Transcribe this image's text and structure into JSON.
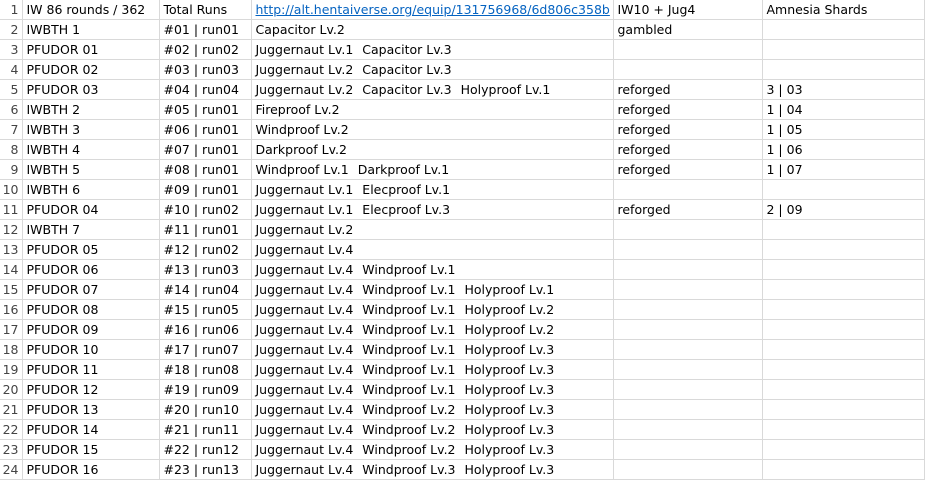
{
  "header": {
    "row_num": "1",
    "a": "IW 86 rounds / 362",
    "b": "Total Runs",
    "c": "http://alt.hentaiverse.org/equip/131756968/6d806c358b",
    "d": "IW10 + Jug4",
    "e": "Amnesia Shards"
  },
  "rows": [
    {
      "num": "2",
      "name": "IWBTH 1",
      "run": "#01 | run01",
      "p1": "Capacitor Lv.2",
      "p2": "",
      "p3": "",
      "status": "gambled",
      "shards": ""
    },
    {
      "num": "3",
      "name": "PFUDOR 01",
      "run": "#02 | run02",
      "p1": "Juggernaut Lv.1",
      "p2": "Capacitor Lv.3",
      "p3": "",
      "status": "",
      "shards": ""
    },
    {
      "num": "4",
      "name": "PFUDOR 02",
      "run": "#03 | run03",
      "p1": "Juggernaut Lv.2",
      "p2": "Capacitor Lv.3",
      "p3": "",
      "status": "",
      "shards": ""
    },
    {
      "num": "5",
      "name": "PFUDOR 03",
      "run": "#04 | run04",
      "p1": "Juggernaut Lv.2",
      "p2": "Capacitor Lv.3",
      "p3": "Holyproof Lv.1",
      "status": "reforged",
      "shards": "3 | 03"
    },
    {
      "num": "6",
      "name": "IWBTH 2",
      "run": "#05 | run01",
      "p1": "Fireproof Lv.2",
      "p2": "",
      "p3": "",
      "status": "reforged",
      "shards": "1 | 04"
    },
    {
      "num": "7",
      "name": "IWBTH 3",
      "run": "#06 | run01",
      "p1": "Windproof Lv.2",
      "p2": "",
      "p3": "",
      "status": "reforged",
      "shards": "1 | 05"
    },
    {
      "num": "8",
      "name": "IWBTH 4",
      "run": "#07 | run01",
      "p1": "Darkproof Lv.2",
      "p2": "",
      "p3": "",
      "status": "reforged",
      "shards": "1 | 06"
    },
    {
      "num": "9",
      "name": "IWBTH 5",
      "run": "#08 | run01",
      "p1": "Windproof Lv.1",
      "p2": "Darkproof Lv.1",
      "p3": "",
      "status": "reforged",
      "shards": "1 | 07"
    },
    {
      "num": "10",
      "name": "IWBTH 6",
      "run": "#09 | run01",
      "p1": "Juggernaut Lv.1",
      "p2": "Elecproof Lv.1",
      "p3": "",
      "status": "",
      "shards": ""
    },
    {
      "num": "11",
      "name": "PFUDOR 04",
      "run": "#10 | run02",
      "p1": "Juggernaut Lv.1",
      "p2": "Elecproof Lv.3",
      "p3": "",
      "status": "reforged",
      "shards": "2 | 09"
    },
    {
      "num": "12",
      "name": "IWBTH 7",
      "run": "#11 | run01",
      "p1": "Juggernaut Lv.2",
      "p2": "",
      "p3": "",
      "status": "",
      "shards": ""
    },
    {
      "num": "13",
      "name": "PFUDOR 05",
      "run": "#12 | run02",
      "p1": "Juggernaut Lv.4",
      "p2": "",
      "p3": "",
      "status": "",
      "shards": ""
    },
    {
      "num": "14",
      "name": "PFUDOR 06",
      "run": "#13 | run03",
      "p1": "Juggernaut Lv.4",
      "p2": "Windproof Lv.1",
      "p3": "",
      "status": "",
      "shards": ""
    },
    {
      "num": "15",
      "name": "PFUDOR 07",
      "run": "#14 | run04",
      "p1": "Juggernaut Lv.4",
      "p2": "Windproof Lv.1",
      "p3": "Holyproof Lv.1",
      "status": "",
      "shards": ""
    },
    {
      "num": "16",
      "name": "PFUDOR 08",
      "run": "#15 | run05",
      "p1": "Juggernaut Lv.4",
      "p2": "Windproof Lv.1",
      "p3": "Holyproof Lv.2",
      "status": "",
      "shards": ""
    },
    {
      "num": "17",
      "name": "PFUDOR 09",
      "run": "#16 | run06",
      "p1": "Juggernaut Lv.4",
      "p2": "Windproof Lv.1",
      "p3": "Holyproof Lv.2",
      "status": "",
      "shards": ""
    },
    {
      "num": "18",
      "name": "PFUDOR 10",
      "run": "#17 | run07",
      "p1": "Juggernaut Lv.4",
      "p2": "Windproof Lv.1",
      "p3": "Holyproof Lv.3",
      "status": "",
      "shards": ""
    },
    {
      "num": "19",
      "name": "PFUDOR 11",
      "run": "#18 | run08",
      "p1": "Juggernaut Lv.4",
      "p2": "Windproof Lv.1",
      "p3": "Holyproof Lv.3",
      "status": "",
      "shards": ""
    },
    {
      "num": "20",
      "name": "PFUDOR 12",
      "run": "#19 | run09",
      "p1": "Juggernaut Lv.4",
      "p2": "Windproof Lv.1",
      "p3": "Holyproof Lv.3",
      "status": "",
      "shards": ""
    },
    {
      "num": "21",
      "name": "PFUDOR 13",
      "run": "#20 | run10",
      "p1": "Juggernaut Lv.4",
      "p2": "Windproof Lv.2",
      "p3": "Holyproof Lv.3",
      "status": "",
      "shards": ""
    },
    {
      "num": "22",
      "name": "PFUDOR 14",
      "run": "#21 | run11",
      "p1": "Juggernaut Lv.4",
      "p2": "Windproof Lv.2",
      "p3": "Holyproof Lv.3",
      "status": "",
      "shards": ""
    },
    {
      "num": "23",
      "name": "PFUDOR 15",
      "run": "#22 | run12",
      "p1": "Juggernaut Lv.4",
      "p2": "Windproof Lv.2",
      "p3": "Holyproof Lv.3",
      "status": "",
      "shards": ""
    },
    {
      "num": "24",
      "name": "PFUDOR 16",
      "run": "#23 | run13",
      "p1": "Juggernaut Lv.4",
      "p2": "Windproof Lv.3",
      "p3": "Holyproof Lv.3",
      "status": "",
      "shards": ""
    }
  ]
}
